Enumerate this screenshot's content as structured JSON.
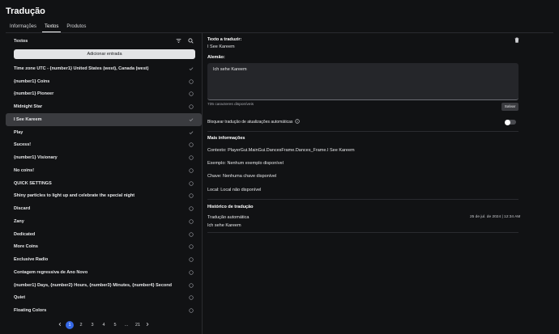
{
  "page": {
    "title": "Tradução"
  },
  "tabs": [
    {
      "label": "Informações"
    },
    {
      "label": "Textos"
    },
    {
      "label": "Produtos"
    }
  ],
  "left": {
    "header": "Textos",
    "add_button": "Adicionar entrada",
    "items": [
      {
        "label": "Time zone UTC - {number1} United States (west), Canada (west)",
        "status": "check"
      },
      {
        "label": "{number1} Coins",
        "status": "pending"
      },
      {
        "label": "{number1} Pioneer",
        "status": "pending"
      },
      {
        "label": "Midnight Star",
        "status": "pending"
      },
      {
        "label": "I See Kareem",
        "status": "check"
      },
      {
        "label": "Play",
        "status": "check"
      },
      {
        "label": "Sucess!",
        "status": "pending"
      },
      {
        "label": "{number1} Visionary",
        "status": "pending"
      },
      {
        "label": "No coins!",
        "status": "pending"
      },
      {
        "label": "QUICK SETTINGS",
        "status": "pending"
      },
      {
        "label": "Shiny particles to light up and celebrate the special night",
        "status": "pending"
      },
      {
        "label": "Discard",
        "status": "pending"
      },
      {
        "label": "Zany",
        "status": "pending"
      },
      {
        "label": "Dedicated",
        "status": "pending"
      },
      {
        "label": "More Coins",
        "status": "pending"
      },
      {
        "label": "Exclusive Radio",
        "status": "pending"
      },
      {
        "label": "Contagem regressiva de Ano Novo",
        "status": "pending"
      },
      {
        "label": "{number1} Days, {number2} Hours, {number3} Minutes, {number4} Second",
        "status": "pending"
      },
      {
        "label": "Quiet",
        "status": "pending"
      },
      {
        "label": "Floating Colors",
        "status": "pending"
      }
    ],
    "pagination": {
      "pages": [
        "1",
        "2",
        "3",
        "4",
        "5",
        "...",
        "21"
      ],
      "current": "1"
    }
  },
  "right": {
    "source_label": "Texto a traduzir:",
    "source_text": "I See Kareem",
    "language_label": "Alemão:",
    "translation_value": "Ich sehe Kareem",
    "chars_remaining": "735 caracteres disponíveis",
    "save_label": "Salvar",
    "block_label": "Bloquear tradução de atualizações automáticas",
    "block_toggle": "off",
    "more_title": "Mais informações",
    "info": [
      {
        "key": "Contexto:",
        "value": "PlayerGui.MainGui.DancesFrame.Dances_Frame.I See Kareem"
      },
      {
        "key": "Exemplo:",
        "value": "Nenhum exemplo disponível"
      },
      {
        "key": "Chave:",
        "value": "Nenhuma chave disponível"
      },
      {
        "key": "Local:",
        "value": "Local não disponível"
      }
    ],
    "history_title": "Histórico de tradução",
    "history": [
      {
        "name": "Tradução automática",
        "date": "25 de jul. de 2024 | 12:34 AM",
        "text": "Ich sehe Kareem"
      }
    ]
  }
}
